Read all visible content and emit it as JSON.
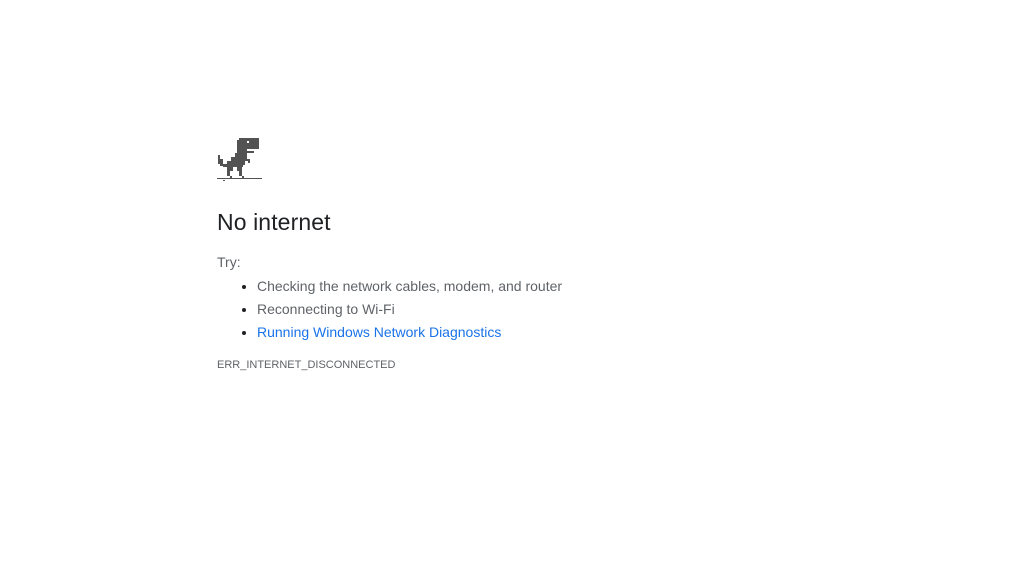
{
  "page": {
    "icon": "dino-icon",
    "title": "No internet",
    "try_label": "Try:",
    "suggestions": [
      "Checking the network cables, modem, and router",
      "Reconnecting to Wi-Fi"
    ],
    "diagnostics_link": "Running Windows Network Diagnostics",
    "error_code": "ERR_INTERNET_DISCONNECTED",
    "colors": {
      "title": "#202124",
      "body_text": "#5f6368",
      "link": "#1a73e8",
      "dino": "#535353"
    }
  }
}
